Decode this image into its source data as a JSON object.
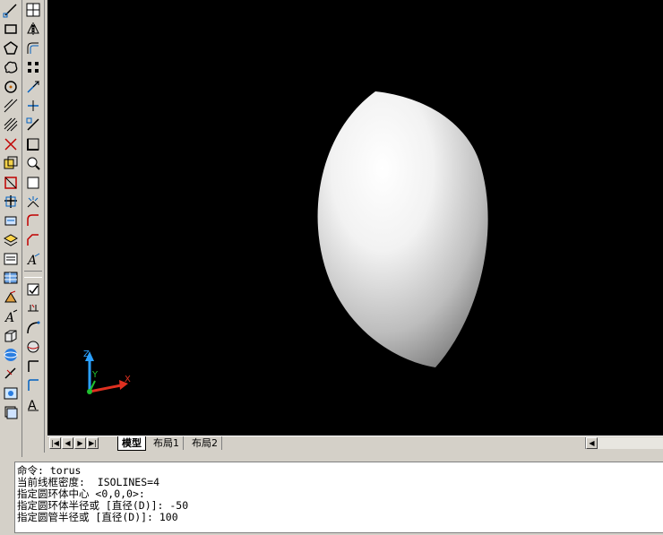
{
  "toolbar_left": {
    "tools": [
      {
        "icon": "line-icon"
      },
      {
        "icon": "rectangle-icon"
      },
      {
        "icon": "polygon-icon"
      },
      {
        "icon": "revcloud-icon"
      },
      {
        "icon": "circle-icon"
      },
      {
        "icon": "construction-line-icon"
      },
      {
        "icon": "hatch-icon"
      },
      {
        "icon": "erase-icon"
      },
      {
        "icon": "copy-icon"
      },
      {
        "icon": "trim-icon"
      },
      {
        "icon": "extend-icon"
      },
      {
        "icon": "insert-block-icon"
      },
      {
        "icon": "layer-icon"
      },
      {
        "icon": "properties-icon"
      },
      {
        "icon": "table-icon"
      },
      {
        "icon": "match-properties-icon"
      },
      {
        "icon": "text-style-icon"
      },
      {
        "icon": "box-3d-icon"
      },
      {
        "icon": "sphere-3d-icon"
      },
      {
        "icon": "measure-icon"
      },
      {
        "icon": "render-icon"
      },
      {
        "icon": "view-cube-icon"
      }
    ]
  },
  "toolbar_right": {
    "tools": [
      {
        "icon": "grid-icon"
      },
      {
        "icon": "mirror-icon"
      },
      {
        "icon": "offset-icon"
      },
      {
        "icon": "array-icon"
      },
      {
        "icon": "move-icon"
      },
      {
        "icon": "rotate-icon"
      },
      {
        "icon": "stretch-icon"
      },
      {
        "icon": "scale-icon"
      },
      {
        "icon": "zoom-icon"
      },
      {
        "icon": "pan-icon"
      },
      {
        "icon": "explode-icon"
      },
      {
        "icon": "fillet-icon"
      },
      {
        "icon": "chamfer-icon"
      },
      {
        "icon": "multiline-text-icon"
      },
      {
        "icon": "edit-text-icon"
      },
      {
        "icon": "dimension-icon"
      },
      {
        "icon": "arc-icon"
      },
      {
        "icon": "sphere-icon"
      },
      {
        "icon": "angle-icon"
      },
      {
        "icon": "leader-icon"
      },
      {
        "icon": "multiline-text-a-icon"
      }
    ]
  },
  "viewport": {
    "background": "#000000",
    "ucs": {
      "x_label": "X",
      "y_label": "Y",
      "z_label": "Z"
    }
  },
  "tabs": {
    "items": [
      {
        "label": "模型",
        "active": true
      },
      {
        "label": "布局1",
        "active": false
      },
      {
        "label": "布局2",
        "active": false
      }
    ],
    "nav": [
      "|◀",
      "◀",
      "▶",
      "▶|"
    ],
    "scroll_left": "◀"
  },
  "command": {
    "lines": [
      "命令: torus",
      "当前线框密度:  ISOLINES=4",
      "指定圆环体中心 <0,0,0>:",
      "指定圆环体半径或 [直径(D)]: -50",
      "指定圆管半径或 [直径(D)]: 100",
      ""
    ]
  }
}
